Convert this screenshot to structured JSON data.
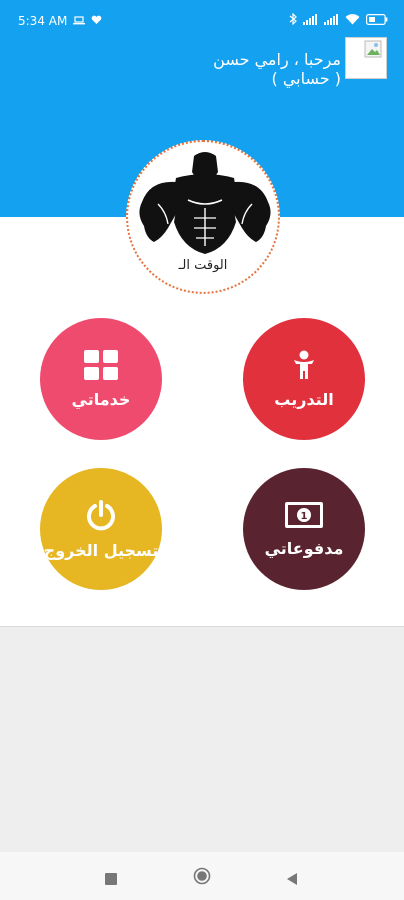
{
  "status_bar": {
    "time": "5:34 AM"
  },
  "header": {
    "greeting_line1": "مرحبا ، رامي حسن",
    "greeting_line2": "( حسابي )"
  },
  "logo": {
    "text": "الوقت الـ"
  },
  "menu": [
    {
      "label": "التدريب",
      "color": "#e1313d",
      "icon": "person-icon"
    },
    {
      "label": "خدماتي",
      "color": "#ef4b6e",
      "icon": "grid-icon"
    },
    {
      "label": "مدفوعاتي",
      "color": "#5a2330",
      "icon": "money-icon"
    },
    {
      "label": "تسجيل الخروج",
      "color": "#e6b722",
      "icon": "power-icon"
    }
  ],
  "colors": {
    "primary": "#14a1ef",
    "background": "#ffffff",
    "lower_area": "#eeeeef"
  }
}
